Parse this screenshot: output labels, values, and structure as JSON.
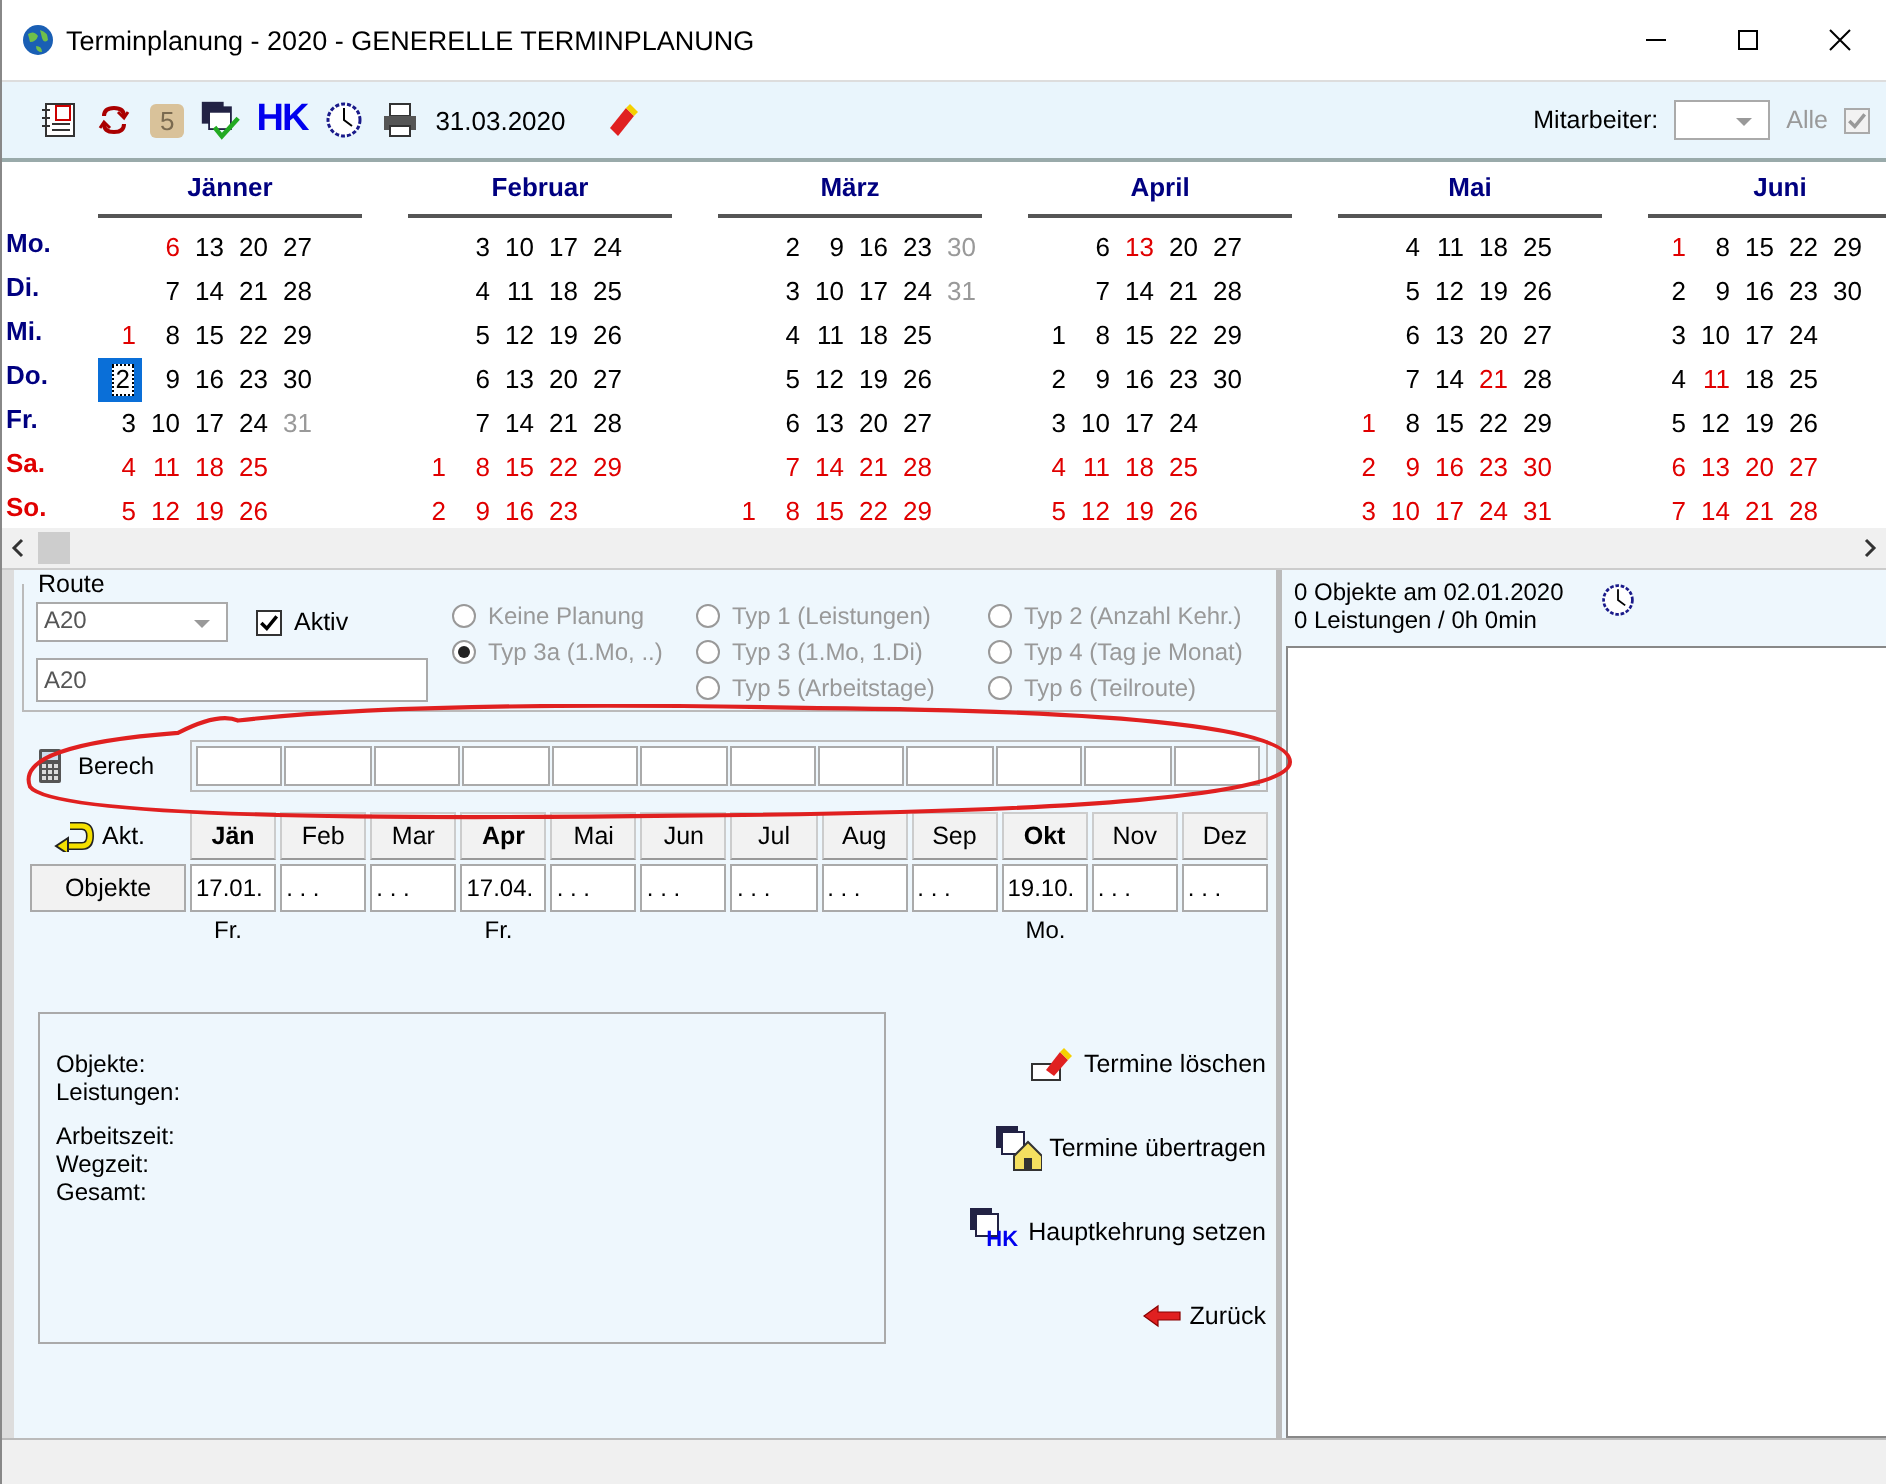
{
  "window": {
    "title": "Terminplanung - 2020 - GENERELLE TERMINPLANUNG"
  },
  "toolbar": {
    "badge": "5",
    "hk_label": "HK",
    "date": "31.03.2020",
    "employee_label": "Mitarbeiter:",
    "all_label": "Alle",
    "all_checked": true,
    "all_disabled": true
  },
  "calendar": {
    "weekdays": [
      {
        "label": "Mo.",
        "weekend": false
      },
      {
        "label": "Di.",
        "weekend": false
      },
      {
        "label": "Mi.",
        "weekend": false
      },
      {
        "label": "Do.",
        "weekend": false
      },
      {
        "label": "Fr.",
        "weekend": false
      },
      {
        "label": "Sa.",
        "weekend": true
      },
      {
        "label": "So.",
        "weekend": true
      }
    ],
    "months": [
      {
        "name": "Jänner",
        "weeks": [
          [
            {
              "kind": "blank"
            },
            {
              "kind": "blank"
            },
            {
              "kind": "day",
              "day": "1",
              "color": "#e00000",
              "selected": false
            },
            {
              "kind": "day",
              "day": "2",
              "color": "#000000",
              "selected": true
            },
            {
              "kind": "day",
              "day": "3",
              "color": "#000000",
              "selected": false
            },
            {
              "kind": "day",
              "day": "4",
              "color": "#e00000",
              "selected": false
            },
            {
              "kind": "day",
              "day": "5",
              "color": "#e00000",
              "selected": false
            }
          ],
          [
            {
              "kind": "day",
              "day": "6",
              "color": "#e00000",
              "selected": false
            },
            {
              "kind": "day",
              "day": "7",
              "color": "#000000",
              "selected": false
            },
            {
              "kind": "day",
              "day": "8",
              "color": "#000000",
              "selected": false
            },
            {
              "kind": "day",
              "day": "9",
              "color": "#000000",
              "selected": false
            },
            {
              "kind": "day",
              "day": "10",
              "color": "#000000",
              "selected": false
            },
            {
              "kind": "day",
              "day": "11",
              "color": "#e00000",
              "selected": false
            },
            {
              "kind": "day",
              "day": "12",
              "color": "#e00000",
              "selected": false
            }
          ],
          [
            {
              "kind": "day",
              "day": "13",
              "color": "#000000",
              "selected": false
            },
            {
              "kind": "day",
              "day": "14",
              "color": "#000000",
              "selected": false
            },
            {
              "kind": "day",
              "day": "15",
              "color": "#000000",
              "selected": false
            },
            {
              "kind": "day",
              "day": "16",
              "color": "#000000",
              "selected": false
            },
            {
              "kind": "day",
              "day": "17",
              "color": "#000000",
              "selected": false
            },
            {
              "kind": "day",
              "day": "18",
              "color": "#e00000",
              "selected": false
            },
            {
              "kind": "day",
              "day": "19",
              "color": "#e00000",
              "selected": false
            }
          ],
          [
            {
              "kind": "day",
              "day": "20",
              "color": "#000000",
              "selected": false
            },
            {
              "kind": "day",
              "day": "21",
              "color": "#000000",
              "selected": false
            },
            {
              "kind": "day",
              "day": "22",
              "color": "#000000",
              "selected": false
            },
            {
              "kind": "day",
              "day": "23",
              "color": "#000000",
              "selected": false
            },
            {
              "kind": "day",
              "day": "24",
              "color": "#000000",
              "selected": false
            },
            {
              "kind": "day",
              "day": "25",
              "color": "#e00000",
              "selected": false
            },
            {
              "kind": "day",
              "day": "26",
              "color": "#e00000",
              "selected": false
            }
          ],
          [
            {
              "kind": "day",
              "day": "27",
              "color": "#000000",
              "selected": false
            },
            {
              "kind": "day",
              "day": "28",
              "color": "#000000",
              "selected": false
            },
            {
              "kind": "day",
              "day": "29",
              "color": "#000000",
              "selected": false
            },
            {
              "kind": "day",
              "day": "30",
              "color": "#000000",
              "selected": false
            },
            {
              "kind": "day",
              "day": "31",
              "color": "#999999",
              "selected": false
            }
          ]
        ]
      },
      {
        "name": "Februar",
        "weeks": [
          [
            {
              "kind": "blank"
            },
            {
              "kind": "blank"
            },
            {
              "kind": "blank"
            },
            {
              "kind": "blank"
            },
            {
              "kind": "blank"
            },
            {
              "kind": "day",
              "day": "1",
              "color": "#e00000",
              "selected": false
            },
            {
              "kind": "day",
              "day": "2",
              "color": "#e00000",
              "selected": false
            }
          ],
          [
            {
              "kind": "day",
              "day": "3",
              "color": "#000000",
              "selected": false
            },
            {
              "kind": "day",
              "day": "4",
              "color": "#000000",
              "selected": false
            },
            {
              "kind": "day",
              "day": "5",
              "color": "#000000",
              "selected": false
            },
            {
              "kind": "day",
              "day": "6",
              "color": "#000000",
              "selected": false
            },
            {
              "kind": "day",
              "day": "7",
              "color": "#000000",
              "selected": false
            },
            {
              "kind": "day",
              "day": "8",
              "color": "#e00000",
              "selected": false
            },
            {
              "kind": "day",
              "day": "9",
              "color": "#e00000",
              "selected": false
            }
          ],
          [
            {
              "kind": "day",
              "day": "10",
              "color": "#000000",
              "selected": false
            },
            {
              "kind": "day",
              "day": "11",
              "color": "#000000",
              "selected": false
            },
            {
              "kind": "day",
              "day": "12",
              "color": "#000000",
              "selected": false
            },
            {
              "kind": "day",
              "day": "13",
              "color": "#000000",
              "selected": false
            },
            {
              "kind": "day",
              "day": "14",
              "color": "#000000",
              "selected": false
            },
            {
              "kind": "day",
              "day": "15",
              "color": "#e00000",
              "selected": false
            },
            {
              "kind": "day",
              "day": "16",
              "color": "#e00000",
              "selected": false
            }
          ],
          [
            {
              "kind": "day",
              "day": "17",
              "color": "#000000",
              "selected": false
            },
            {
              "kind": "day",
              "day": "18",
              "color": "#000000",
              "selected": false
            },
            {
              "kind": "day",
              "day": "19",
              "color": "#000000",
              "selected": false
            },
            {
              "kind": "day",
              "day": "20",
              "color": "#000000",
              "selected": false
            },
            {
              "kind": "day",
              "day": "21",
              "color": "#000000",
              "selected": false
            },
            {
              "kind": "day",
              "day": "22",
              "color": "#e00000",
              "selected": false
            },
            {
              "kind": "day",
              "day": "23",
              "color": "#e00000",
              "selected": false
            }
          ],
          [
            {
              "kind": "day",
              "day": "24",
              "color": "#000000",
              "selected": false
            },
            {
              "kind": "day",
              "day": "25",
              "color": "#000000",
              "selected": false
            },
            {
              "kind": "day",
              "day": "26",
              "color": "#000000",
              "selected": false
            },
            {
              "kind": "day",
              "day": "27",
              "color": "#000000",
              "selected": false
            },
            {
              "kind": "day",
              "day": "28",
              "color": "#000000",
              "selected": false
            },
            {
              "kind": "day",
              "day": "29",
              "color": "#e00000",
              "selected": false
            }
          ]
        ]
      },
      {
        "name": "März",
        "weeks": [
          [
            {
              "kind": "blank"
            },
            {
              "kind": "blank"
            },
            {
              "kind": "blank"
            },
            {
              "kind": "blank"
            },
            {
              "kind": "blank"
            },
            {
              "kind": "blank"
            },
            {
              "kind": "day",
              "day": "1",
              "color": "#e00000",
              "selected": false
            }
          ],
          [
            {
              "kind": "day",
              "day": "2",
              "color": "#000000",
              "selected": false
            },
            {
              "kind": "day",
              "day": "3",
              "color": "#000000",
              "selected": false
            },
            {
              "kind": "day",
              "day": "4",
              "color": "#000000",
              "selected": false
            },
            {
              "kind": "day",
              "day": "5",
              "color": "#000000",
              "selected": false
            },
            {
              "kind": "day",
              "day": "6",
              "color": "#000000",
              "selected": false
            },
            {
              "kind": "day",
              "day": "7",
              "color": "#e00000",
              "selected": false
            },
            {
              "kind": "day",
              "day": "8",
              "color": "#e00000",
              "selected": false
            }
          ],
          [
            {
              "kind": "day",
              "day": "9",
              "color": "#000000",
              "selected": false
            },
            {
              "kind": "day",
              "day": "10",
              "color": "#000000",
              "selected": false
            },
            {
              "kind": "day",
              "day": "11",
              "color": "#000000",
              "selected": false
            },
            {
              "kind": "day",
              "day": "12",
              "color": "#000000",
              "selected": false
            },
            {
              "kind": "day",
              "day": "13",
              "color": "#000000",
              "selected": false
            },
            {
              "kind": "day",
              "day": "14",
              "color": "#e00000",
              "selected": false
            },
            {
              "kind": "day",
              "day": "15",
              "color": "#e00000",
              "selected": false
            }
          ],
          [
            {
              "kind": "day",
              "day": "16",
              "color": "#000000",
              "selected": false
            },
            {
              "kind": "day",
              "day": "17",
              "color": "#000000",
              "selected": false
            },
            {
              "kind": "day",
              "day": "18",
              "color": "#000000",
              "selected": false
            },
            {
              "kind": "day",
              "day": "19",
              "color": "#000000",
              "selected": false
            },
            {
              "kind": "day",
              "day": "20",
              "color": "#000000",
              "selected": false
            },
            {
              "kind": "day",
              "day": "21",
              "color": "#e00000",
              "selected": false
            },
            {
              "kind": "day",
              "day": "22",
              "color": "#e00000",
              "selected": false
            }
          ],
          [
            {
              "kind": "day",
              "day": "23",
              "color": "#000000",
              "selected": false
            },
            {
              "kind": "day",
              "day": "24",
              "color": "#000000",
              "selected": false
            },
            {
              "kind": "day",
              "day": "25",
              "color": "#000000",
              "selected": false
            },
            {
              "kind": "day",
              "day": "26",
              "color": "#000000",
              "selected": false
            },
            {
              "kind": "day",
              "day": "27",
              "color": "#000000",
              "selected": false
            },
            {
              "kind": "day",
              "day": "28",
              "color": "#e00000",
              "selected": false
            },
            {
              "kind": "day",
              "day": "29",
              "color": "#e00000",
              "selected": false
            }
          ],
          [
            {
              "kind": "day",
              "day": "30",
              "color": "#999999",
              "selected": false
            },
            {
              "kind": "day",
              "day": "31",
              "color": "#999999",
              "selected": false
            }
          ]
        ]
      },
      {
        "name": "April",
        "weeks": [
          [
            {
              "kind": "blank"
            },
            {
              "kind": "blank"
            },
            {
              "kind": "day",
              "day": "1",
              "color": "#000000",
              "selected": false
            },
            {
              "kind": "day",
              "day": "2",
              "color": "#000000",
              "selected": false
            },
            {
              "kind": "day",
              "day": "3",
              "color": "#000000",
              "selected": false
            },
            {
              "kind": "day",
              "day": "4",
              "color": "#e00000",
              "selected": false
            },
            {
              "kind": "day",
              "day": "5",
              "color": "#e00000",
              "selected": false
            }
          ],
          [
            {
              "kind": "day",
              "day": "6",
              "color": "#000000",
              "selected": false
            },
            {
              "kind": "day",
              "day": "7",
              "color": "#000000",
              "selected": false
            },
            {
              "kind": "day",
              "day": "8",
              "color": "#000000",
              "selected": false
            },
            {
              "kind": "day",
              "day": "9",
              "color": "#000000",
              "selected": false
            },
            {
              "kind": "day",
              "day": "10",
              "color": "#000000",
              "selected": false
            },
            {
              "kind": "day",
              "day": "11",
              "color": "#e00000",
              "selected": false
            },
            {
              "kind": "day",
              "day": "12",
              "color": "#e00000",
              "selected": false
            }
          ],
          [
            {
              "kind": "day",
              "day": "13",
              "color": "#e00000",
              "selected": false
            },
            {
              "kind": "day",
              "day": "14",
              "color": "#000000",
              "selected": false
            },
            {
              "kind": "day",
              "day": "15",
              "color": "#000000",
              "selected": false
            },
            {
              "kind": "day",
              "day": "16",
              "color": "#000000",
              "selected": false
            },
            {
              "kind": "day",
              "day": "17",
              "color": "#000000",
              "selected": false
            },
            {
              "kind": "day",
              "day": "18",
              "color": "#e00000",
              "selected": false
            },
            {
              "kind": "day",
              "day": "19",
              "color": "#e00000",
              "selected": false
            }
          ],
          [
            {
              "kind": "day",
              "day": "20",
              "color": "#000000",
              "selected": false
            },
            {
              "kind": "day",
              "day": "21",
              "color": "#000000",
              "selected": false
            },
            {
              "kind": "day",
              "day": "22",
              "color": "#000000",
              "selected": false
            },
            {
              "kind": "day",
              "day": "23",
              "color": "#000000",
              "selected": false
            },
            {
              "kind": "day",
              "day": "24",
              "color": "#000000",
              "selected": false
            },
            {
              "kind": "day",
              "day": "25",
              "color": "#e00000",
              "selected": false
            },
            {
              "kind": "day",
              "day": "26",
              "color": "#e00000",
              "selected": false
            }
          ],
          [
            {
              "kind": "day",
              "day": "27",
              "color": "#000000",
              "selected": false
            },
            {
              "kind": "day",
              "day": "28",
              "color": "#000000",
              "selected": false
            },
            {
              "kind": "day",
              "day": "29",
              "color": "#000000",
              "selected": false
            },
            {
              "kind": "day",
              "day": "30",
              "color": "#000000",
              "selected": false
            }
          ]
        ]
      },
      {
        "name": "Mai",
        "weeks": [
          [
            {
              "kind": "blank"
            },
            {
              "kind": "blank"
            },
            {
              "kind": "blank"
            },
            {
              "kind": "blank"
            },
            {
              "kind": "day",
              "day": "1",
              "color": "#e00000",
              "selected": false
            },
            {
              "kind": "day",
              "day": "2",
              "color": "#e00000",
              "selected": false
            },
            {
              "kind": "day",
              "day": "3",
              "color": "#e00000",
              "selected": false
            }
          ],
          [
            {
              "kind": "day",
              "day": "4",
              "color": "#000000",
              "selected": false
            },
            {
              "kind": "day",
              "day": "5",
              "color": "#000000",
              "selected": false
            },
            {
              "kind": "day",
              "day": "6",
              "color": "#000000",
              "selected": false
            },
            {
              "kind": "day",
              "day": "7",
              "color": "#000000",
              "selected": false
            },
            {
              "kind": "day",
              "day": "8",
              "color": "#000000",
              "selected": false
            },
            {
              "kind": "day",
              "day": "9",
              "color": "#e00000",
              "selected": false
            },
            {
              "kind": "day",
              "day": "10",
              "color": "#e00000",
              "selected": false
            }
          ],
          [
            {
              "kind": "day",
              "day": "11",
              "color": "#000000",
              "selected": false
            },
            {
              "kind": "day",
              "day": "12",
              "color": "#000000",
              "selected": false
            },
            {
              "kind": "day",
              "day": "13",
              "color": "#000000",
              "selected": false
            },
            {
              "kind": "day",
              "day": "14",
              "color": "#000000",
              "selected": false
            },
            {
              "kind": "day",
              "day": "15",
              "color": "#000000",
              "selected": false
            },
            {
              "kind": "day",
              "day": "16",
              "color": "#e00000",
              "selected": false
            },
            {
              "kind": "day",
              "day": "17",
              "color": "#e00000",
              "selected": false
            }
          ],
          [
            {
              "kind": "day",
              "day": "18",
              "color": "#000000",
              "selected": false
            },
            {
              "kind": "day",
              "day": "19",
              "color": "#000000",
              "selected": false
            },
            {
              "kind": "day",
              "day": "20",
              "color": "#000000",
              "selected": false
            },
            {
              "kind": "day",
              "day": "21",
              "color": "#e00000",
              "selected": false
            },
            {
              "kind": "day",
              "day": "22",
              "color": "#000000",
              "selected": false
            },
            {
              "kind": "day",
              "day": "23",
              "color": "#e00000",
              "selected": false
            },
            {
              "kind": "day",
              "day": "24",
              "color": "#e00000",
              "selected": false
            }
          ],
          [
            {
              "kind": "day",
              "day": "25",
              "color": "#000000",
              "selected": false
            },
            {
              "kind": "day",
              "day": "26",
              "color": "#000000",
              "selected": false
            },
            {
              "kind": "day",
              "day": "27",
              "color": "#000000",
              "selected": false
            },
            {
              "kind": "day",
              "day": "28",
              "color": "#000000",
              "selected": false
            },
            {
              "kind": "day",
              "day": "29",
              "color": "#000000",
              "selected": false
            },
            {
              "kind": "day",
              "day": "30",
              "color": "#e00000",
              "selected": false
            },
            {
              "kind": "day",
              "day": "31",
              "color": "#e00000",
              "selected": false
            }
          ]
        ]
      },
      {
        "name": "Juni",
        "weeks": [
          [
            {
              "kind": "day",
              "day": "1",
              "color": "#e00000",
              "selected": false
            },
            {
              "kind": "day",
              "day": "2",
              "color": "#000000",
              "selected": false
            },
            {
              "kind": "day",
              "day": "3",
              "color": "#000000",
              "selected": false
            },
            {
              "kind": "day",
              "day": "4",
              "color": "#000000",
              "selected": false
            },
            {
              "kind": "day",
              "day": "5",
              "color": "#000000",
              "selected": false
            },
            {
              "kind": "day",
              "day": "6",
              "color": "#e00000",
              "selected": false
            },
            {
              "kind": "day",
              "day": "7",
              "color": "#e00000",
              "selected": false
            }
          ],
          [
            {
              "kind": "day",
              "day": "8",
              "color": "#000000",
              "selected": false
            },
            {
              "kind": "day",
              "day": "9",
              "color": "#000000",
              "selected": false
            },
            {
              "kind": "day",
              "day": "10",
              "color": "#000000",
              "selected": false
            },
            {
              "kind": "day",
              "day": "11",
              "color": "#e00000",
              "selected": false
            },
            {
              "kind": "day",
              "day": "12",
              "color": "#000000",
              "selected": false
            },
            {
              "kind": "day",
              "day": "13",
              "color": "#e00000",
              "selected": false
            },
            {
              "kind": "day",
              "day": "14",
              "color": "#e00000",
              "selected": false
            }
          ],
          [
            {
              "kind": "day",
              "day": "15",
              "color": "#000000",
              "selected": false
            },
            {
              "kind": "day",
              "day": "16",
              "color": "#000000",
              "selected": false
            },
            {
              "kind": "day",
              "day": "17",
              "color": "#000000",
              "selected": false
            },
            {
              "kind": "day",
              "day": "18",
              "color": "#000000",
              "selected": false
            },
            {
              "kind": "day",
              "day": "19",
              "color": "#000000",
              "selected": false
            },
            {
              "kind": "day",
              "day": "20",
              "color": "#e00000",
              "selected": false
            },
            {
              "kind": "day",
              "day": "21",
              "color": "#e00000",
              "selected": false
            }
          ],
          [
            {
              "kind": "day",
              "day": "22",
              "color": "#000000",
              "selected": false
            },
            {
              "kind": "day",
              "day": "23",
              "color": "#000000",
              "selected": false
            },
            {
              "kind": "day",
              "day": "24",
              "color": "#000000",
              "selected": false
            },
            {
              "kind": "day",
              "day": "25",
              "color": "#000000",
              "selected": false
            },
            {
              "kind": "day",
              "day": "26",
              "color": "#000000",
              "selected": false
            },
            {
              "kind": "day",
              "day": "27",
              "color": "#e00000",
              "selected": false
            },
            {
              "kind": "day",
              "day": "28",
              "color": "#e00000",
              "selected": false
            }
          ],
          [
            {
              "kind": "day",
              "day": "29",
              "color": "#000000",
              "selected": false
            },
            {
              "kind": "day",
              "day": "30",
              "color": "#000000",
              "selected": false
            }
          ]
        ]
      }
    ]
  },
  "route": {
    "legend": "Route",
    "combo_value": "A20",
    "active_label": "Aktiv",
    "active_checked": true,
    "name_value": "A20",
    "radio_rows": [
      [
        {
          "label": "Keine Planung",
          "selected": false,
          "disabled": true
        },
        {
          "label": "Typ 1 (Leistungen)",
          "selected": false,
          "disabled": true
        },
        {
          "label": "Typ 2 (Anzahl Kehr.)",
          "selected": false,
          "disabled": true
        }
      ],
      [
        {
          "label": "Typ 3a (1.Mo, ..)",
          "selected": true,
          "disabled": true
        },
        {
          "label": "Typ 3 (1.Mo, 1.Di)",
          "selected": false,
          "disabled": true
        },
        {
          "label": "Typ 4 (Tag je Monat)",
          "selected": false,
          "disabled": true
        }
      ],
      [
        {
          "label": "Typ 5 (Arbeitstage)",
          "selected": false,
          "disabled": true
        },
        {
          "label": "Typ 6 (Teilroute)",
          "selected": false,
          "disabled": true
        }
      ]
    ]
  },
  "schedule": {
    "berech_label": "Berech",
    "akt_label": "Akt.",
    "objects_button": "Objekte",
    "months": [
      {
        "label": "Jän",
        "bold": true,
        "date": "17.01.",
        "weekday": "Fr."
      },
      {
        "label": "Feb",
        "bold": false,
        "date": ". . ."
      },
      {
        "label": "Mar",
        "bold": false,
        "date": ". . ."
      },
      {
        "label": "Apr",
        "bold": true,
        "date": "17.04.",
        "weekday": "Fr."
      },
      {
        "label": "Mai",
        "bold": false,
        "date": ". . ."
      },
      {
        "label": "Jun",
        "bold": false,
        "date": ". . ."
      },
      {
        "label": "Jul",
        "bold": false,
        "date": ". . ."
      },
      {
        "label": "Aug",
        "bold": false,
        "date": ". . ."
      },
      {
        "label": "Sep",
        "bold": false,
        "date": ". . ."
      },
      {
        "label": "Okt",
        "bold": true,
        "date": "19.10.",
        "weekday": "Mo."
      },
      {
        "label": "Nov",
        "bold": false,
        "date": ". . ."
      },
      {
        "label": "Dez",
        "bold": false,
        "date": ". . ."
      }
    ]
  },
  "summary": {
    "groups": [
      [
        "Objekte:",
        "Leistungen:"
      ],
      [
        "Arbeitszeit:",
        "Wegzeit:",
        "Gesamt:"
      ]
    ]
  },
  "actions": [
    {
      "label": "Termine löschen",
      "kind": "delete"
    },
    {
      "label": "Termine übertragen",
      "kind": "transfer"
    },
    {
      "label": "Hauptkehrung setzen",
      "kind": "main",
      "icon_text": "HK"
    },
    {
      "label": "Zurück",
      "kind": "back"
    }
  ],
  "day_info": {
    "lines": [
      "0 Objekte am 02.01.2020",
      "0 Leistungen / 0h 0min"
    ]
  }
}
